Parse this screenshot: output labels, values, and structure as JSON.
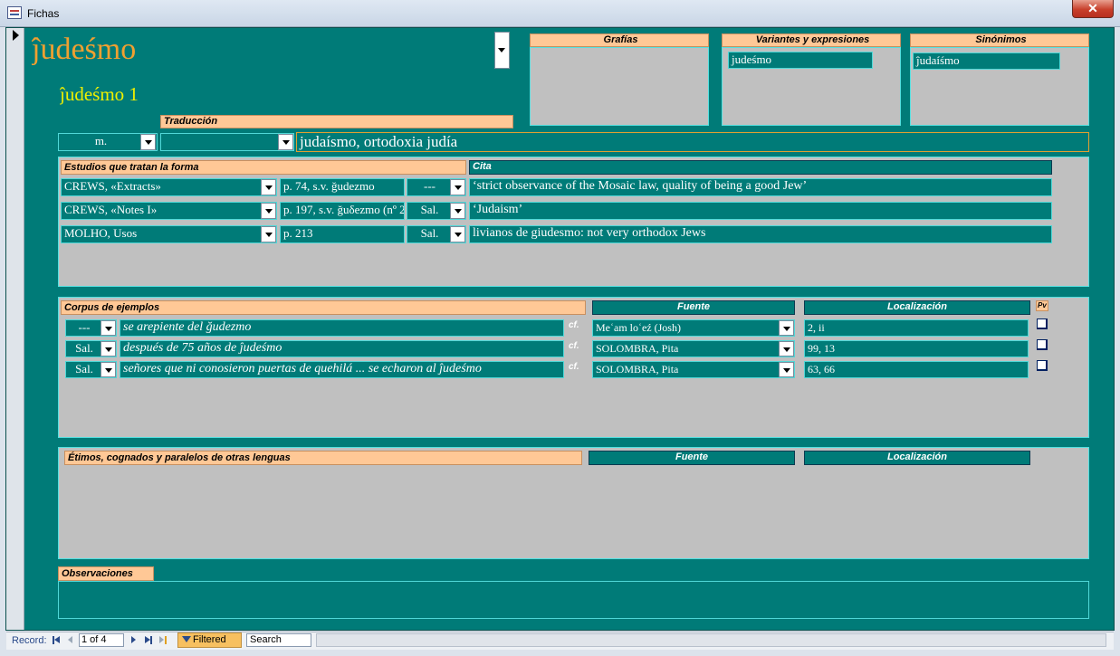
{
  "window": {
    "title": "Fichas",
    "close_label": "✕"
  },
  "entry": {
    "headword": "ĵudeśmo",
    "subheadword": "ĵudeśmo 1"
  },
  "boxes": {
    "grafias": {
      "title": "Grafías",
      "items": []
    },
    "variantes": {
      "title": "Variantes y expresiones",
      "items": [
        "judeśmo"
      ]
    },
    "sinonimos": {
      "title": "Sinónimos",
      "items": [
        "ĵudaíśmo"
      ]
    }
  },
  "traduccion": {
    "label": "Traducción",
    "gender": "m.",
    "type": "",
    "value": "judaísmo, ortodoxia judía"
  },
  "estudios": {
    "title": "Estudios que tratan la forma",
    "cita_header": "Cita",
    "rows": [
      {
        "source": "CREWS, «Extracts»",
        "page": "p. 74, s.v. ğudezmo",
        "region": "---",
        "cita": "‘strict observance of the Mosaic law, quality of being a good Jew’"
      },
      {
        "source": "CREWS, «Notes I»",
        "page": "p. 197, s.v. ğuδezmo (nº 2",
        "region": "Sal.",
        "cita": "‘Judaism’"
      },
      {
        "source": "MOLHO, Usos",
        "page": "p. 213",
        "region": "Sal.",
        "cita": "livianos de giudesmo: not very orthodox Jews"
      }
    ]
  },
  "corpus": {
    "title": "Corpus de ejemplos",
    "fuente_header": "Fuente",
    "localizacion_header": "Localización",
    "pv_header": "Pv",
    "cf_label": "cf.",
    "rows": [
      {
        "region": "---",
        "example": "se arepiente del ğudezmo",
        "fuente": "Meʿam loʿeź (Josh)",
        "loc": "2, ii"
      },
      {
        "region": "Sal.",
        "example": "después de 75 años de ĵudeśmo",
        "fuente": "SOLOMBRA, Pita",
        "loc": "99, 13"
      },
      {
        "region": "Sal.",
        "example": "señores que ni conosieron puertas de quehilá ... se echaron al ĵudeśmo",
        "fuente": "SOLOMBRA, Pita",
        "loc": "63, 66"
      }
    ]
  },
  "etimos": {
    "title": "Étimos, cognados y paralelos de otras lenguas",
    "fuente_header": "Fuente",
    "localizacion_header": "Localización"
  },
  "observaciones": {
    "title": "Observaciones",
    "value": ""
  },
  "navigation": {
    "record_label": "Record:",
    "record_value": "1 of 4",
    "filtered_label": "Filtered",
    "search_label": "Search"
  }
}
